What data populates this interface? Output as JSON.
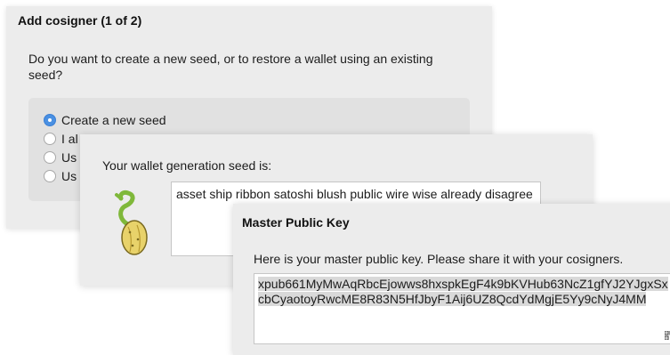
{
  "add_cosigner": {
    "title": "Add cosigner (1 of 2)",
    "question": "Do you want to create a new seed, or to restore a wallet using an existing seed?",
    "options": [
      {
        "label": "Create a new seed",
        "selected": true
      },
      {
        "label": "I al",
        "selected": false
      },
      {
        "label": "Us",
        "selected": false
      },
      {
        "label": "Us",
        "selected": false
      }
    ]
  },
  "seed_dialog": {
    "label": "Your wallet generation seed is:",
    "seed": "asset ship ribbon satoshi blush public wire wise already disagree",
    "icon": "electrum-seed-icon"
  },
  "mpk_dialog": {
    "title": "Master Public Key",
    "description": "Here is your master public key. Please share it with your cosigners.",
    "key": "xpub661MyMwAqRbcEjowws8hxspkEgF4k9bKVHub63NcZ1gfYJ2YJgxSxcbCyaotoyRwcME8R83N5HfJbyF1Aij6UZ8QcdYdMgjE5Yy9cNyJ4MM",
    "qr_icon": "qr-code-icon"
  },
  "colors": {
    "accent": "#4a90e2",
    "panel": "#ececec",
    "selection": "#d9d9d9"
  }
}
